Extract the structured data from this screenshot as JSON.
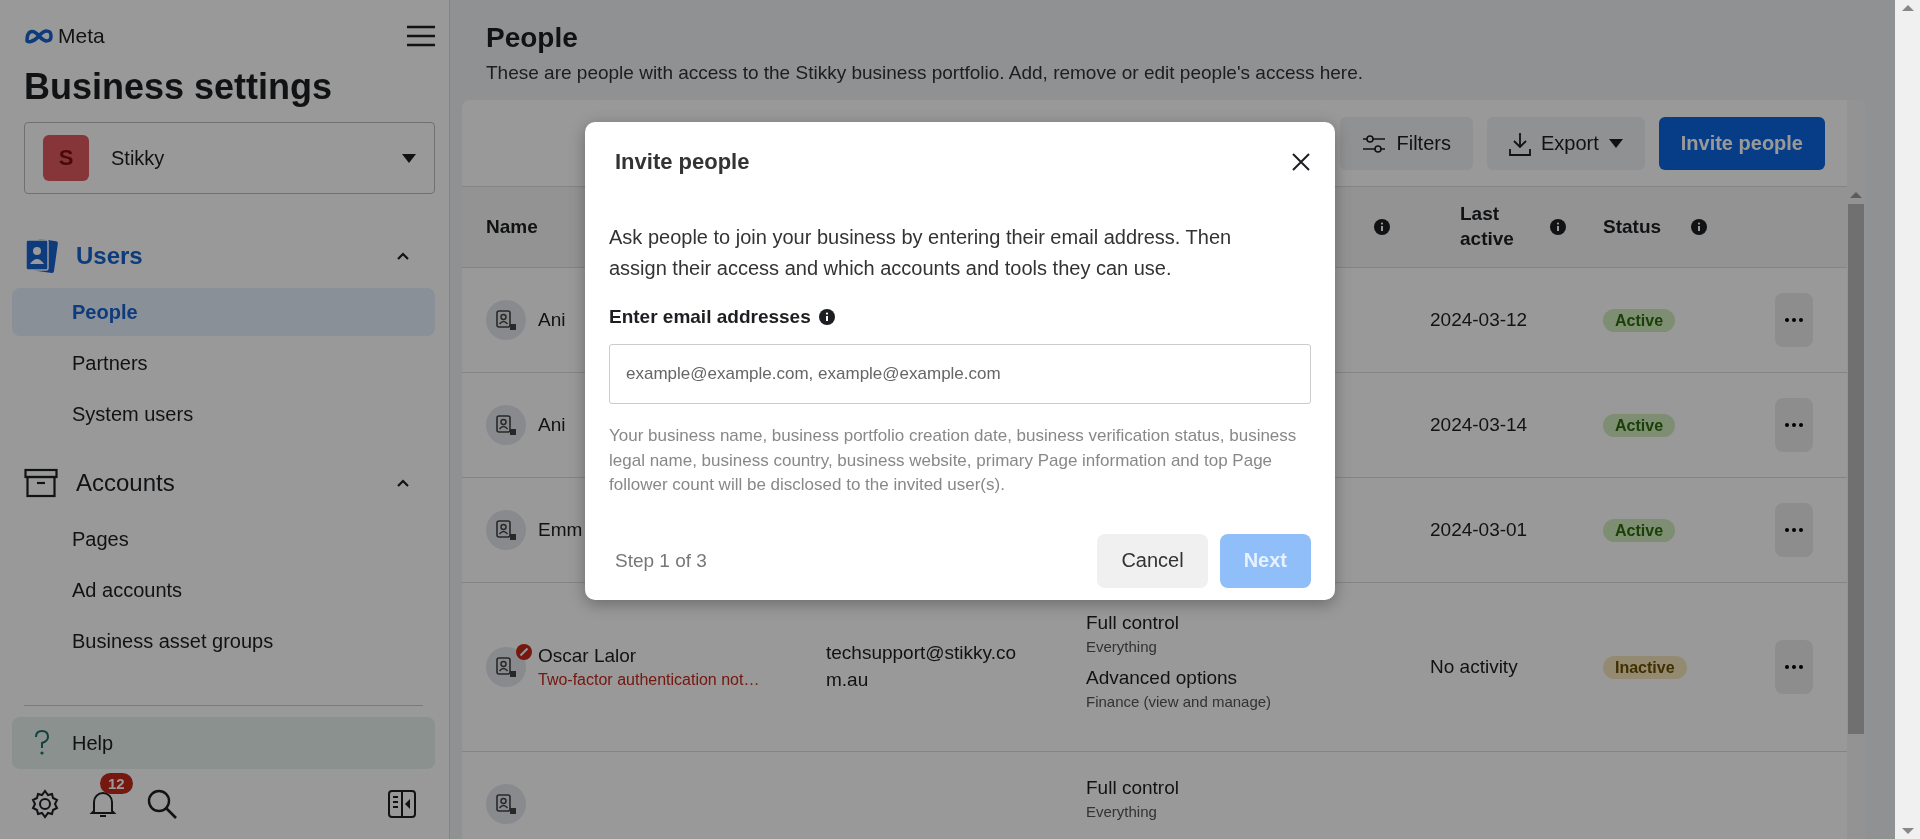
{
  "sidebar": {
    "brand": "Meta",
    "title": "Business settings",
    "business": {
      "initial": "S",
      "name": "Stikky"
    },
    "sections": [
      {
        "label": "Users",
        "selected": true,
        "expanded": true,
        "items": [
          {
            "label": "People",
            "selected": true
          },
          {
            "label": "Partners",
            "selected": false
          },
          {
            "label": "System users",
            "selected": false
          }
        ]
      },
      {
        "label": "Accounts",
        "selected": false,
        "expanded": true,
        "items": [
          {
            "label": "Pages",
            "selected": false
          },
          {
            "label": "Ad accounts",
            "selected": false
          },
          {
            "label": "Business asset groups",
            "selected": false
          }
        ]
      }
    ],
    "help": "Help",
    "notification_count": "12"
  },
  "page": {
    "title": "People",
    "description": "These are people with access to the Stikky business portfolio. Add, remove or edit people's access here."
  },
  "toolbar": {
    "filters": "Filters",
    "export": "Export",
    "invite": "Invite people"
  },
  "table": {
    "columns": [
      {
        "label": "Name"
      },
      {
        "label": "Last active"
      },
      {
        "label": "Status"
      }
    ],
    "rows": [
      {
        "name": "Ani",
        "last_active": "2024-03-12",
        "status": {
          "label": "Active",
          "kind": "active"
        }
      },
      {
        "name": "Ani",
        "last_active": "2024-03-14",
        "status": {
          "label": "Active",
          "kind": "active"
        }
      },
      {
        "name": "Emm",
        "last_active": "2024-03-01",
        "status": {
          "label": "Active",
          "kind": "active"
        }
      },
      {
        "name": "Oscar Lalor",
        "warning": "Two-factor authentication not…",
        "email": "techsupport@stikky.com.au",
        "access": [
          {
            "title": "Full control",
            "detail": "Everything"
          },
          {
            "title": "Advanced options",
            "detail": "Finance (view and manage)"
          }
        ],
        "last_active": "No activity",
        "status": {
          "label": "Inactive",
          "kind": "inactive"
        }
      },
      {
        "access": [
          {
            "title": "Full control",
            "detail": "Everything"
          }
        ]
      }
    ]
  },
  "dialog": {
    "title": "Invite people",
    "intro": "Ask people to join your business by entering their email address. Then assign their access and which accounts and tools they can use.",
    "field_label": "Enter email addresses",
    "placeholder": "example@example.com, example@example.com",
    "disclaimer": "Your business name, business portfolio creation date, business verification status, business legal name, business country, business website, primary Page information and top Page follower count will be disclosed to the invited user(s).",
    "step": "Step 1 of 3",
    "cancel": "Cancel",
    "next": {
      "label": "Next",
      "disabled": true
    }
  }
}
